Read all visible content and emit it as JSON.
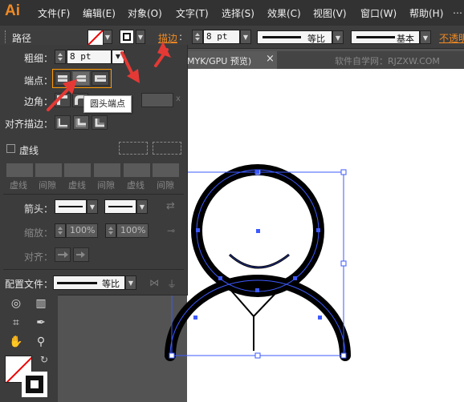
{
  "app": {
    "logo": "Ai"
  },
  "menu": [
    "文件(F)",
    "编辑(E)",
    "对象(O)",
    "文字(T)",
    "选择(S)",
    "效果(C)",
    "视图(V)",
    "窗口(W)",
    "帮助(H)"
  ],
  "control": {
    "label": "路径",
    "stroke_label": "描边",
    "stroke_colon": ":",
    "stroke_weight": "8 pt",
    "profile_label": "等比",
    "brush_label": "基本",
    "opacity_label": "不透明"
  },
  "tab": {
    "title": "MYK/GPU 预览)",
    "close": "×",
    "watermark": "软件自学网：RJZXW.COM"
  },
  "panel": {
    "weight_label": "粗细：",
    "weight_value": "8 pt",
    "cap_label": "端点：",
    "corner_label": "边角：",
    "align_label": "对齐描边：",
    "dashed_label": "虚线",
    "dash_labels": [
      "虚线",
      "间隙",
      "虚线",
      "间隙",
      "虚线",
      "间隙"
    ],
    "arrow_label": "箭头：",
    "scale_label": "缩放：",
    "scale_start": "100%",
    "scale_end": "100%",
    "align2_label": "对齐：",
    "profile_label": "配置文件：",
    "profile_value": "等比"
  },
  "tooltip": "圆头端点",
  "colors": {
    "accent": "#f08a24",
    "annotation_arrow": "#e53935",
    "selection": "#3d5afe"
  },
  "icons": [
    "chevron-down-icon",
    "butt-cap-icon",
    "round-cap-icon",
    "projecting-cap-icon",
    "miter-join-icon",
    "round-join-icon",
    "align-center-icon",
    "align-inside-icon",
    "align-outside-icon",
    "lasso-icon",
    "graph-icon",
    "artboard-icon",
    "eyedropper-icon",
    "hand-icon",
    "zoom-icon",
    "swap-icon"
  ]
}
